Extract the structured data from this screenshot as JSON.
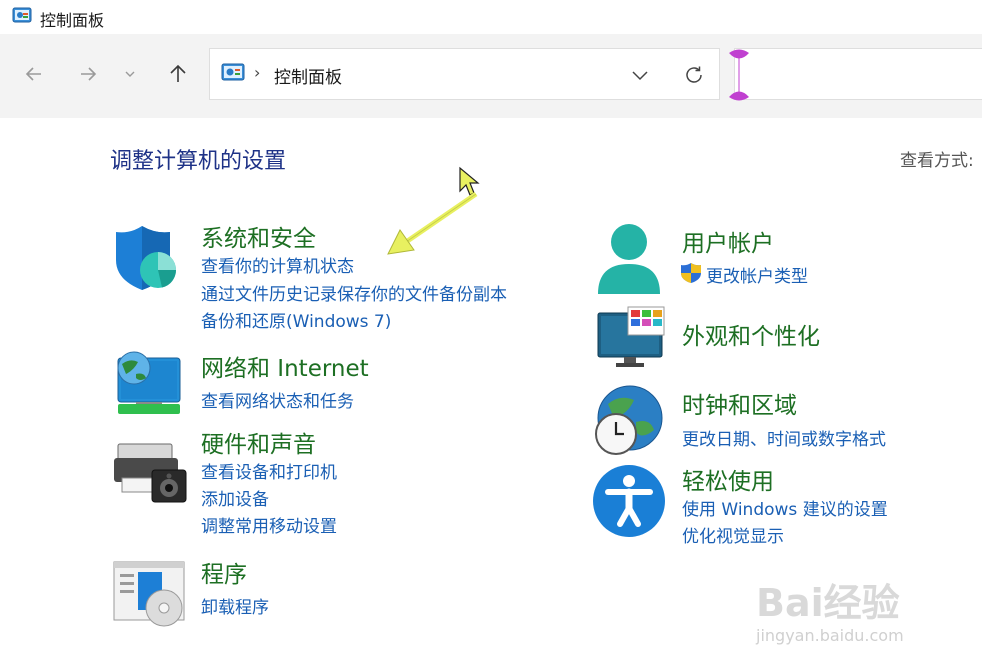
{
  "window": {
    "title": "控制面板"
  },
  "address_bar": {
    "path": "控制面板"
  },
  "content": {
    "heading": "调整计算机的设置",
    "view_by": "查看方式:"
  },
  "categories": {
    "system_security": {
      "title": "系统和安全",
      "links": [
        "查看你的计算机状态",
        "通过文件历史记录保存你的文件备份副本",
        "备份和还原(Windows 7)"
      ]
    },
    "network": {
      "title": "网络和 Internet",
      "links": [
        "查看网络状态和任务"
      ]
    },
    "hardware": {
      "title": "硬件和声音",
      "links": [
        "查看设备和打印机",
        "添加设备",
        "调整常用移动设置"
      ]
    },
    "programs": {
      "title": "程序",
      "links": [
        "卸载程序"
      ]
    },
    "user_accounts": {
      "title": "用户帐户",
      "links": [
        "更改帐户类型"
      ]
    },
    "appearance": {
      "title": "外观和个性化",
      "links": []
    },
    "clock_region": {
      "title": "时钟和区域",
      "links": [
        "更改日期、时间或数字格式"
      ]
    },
    "ease_of_access": {
      "title": "轻松使用",
      "links": [
        "使用 Windows 建议的设置",
        "优化视觉显示"
      ]
    }
  },
  "watermark": {
    "main": "Bai经验",
    "sub": "jingyan.baidu.com"
  },
  "colors": {
    "category_title": "#1d6f23",
    "link": "#1a5fb4",
    "heading": "#1e3287",
    "annotation": "#e8f060"
  }
}
